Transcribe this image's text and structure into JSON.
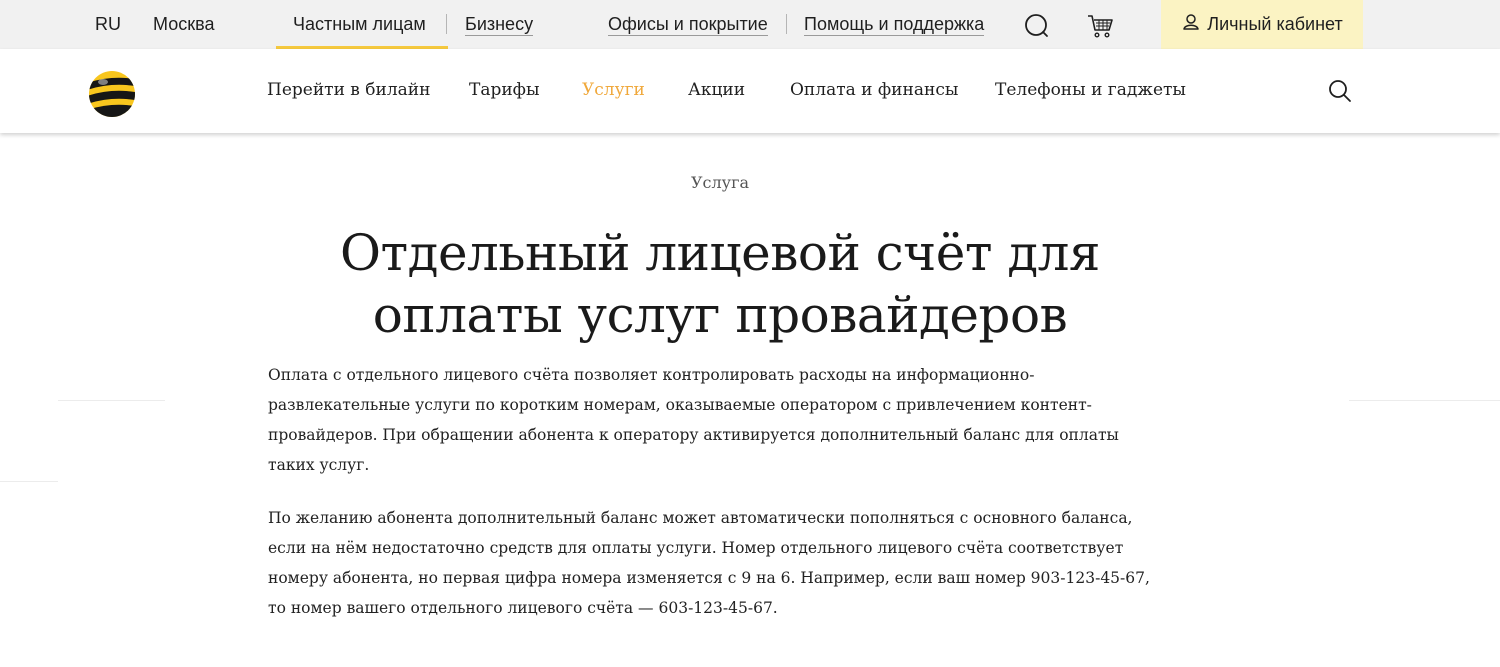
{
  "topbar": {
    "lang": "RU",
    "city": "Москва",
    "segments": {
      "private": "Частным лицам",
      "business": "Бизнесу"
    },
    "offices": "Офисы и покрытие",
    "help": "Помощь и поддержка",
    "cabinet": "Личный кабинет"
  },
  "nav": {
    "items": [
      "Перейти в билайн",
      "Тарифы",
      "Услуги",
      "Акции",
      "Оплата и финансы",
      "Телефоны и гаджеты"
    ],
    "active_index": 2
  },
  "content": {
    "eyebrow": "Услуга",
    "title_line1": "Отдельный лицевой счёт для",
    "title_line2": "оплаты услуг провайдеров",
    "paragraphs": [
      "Оплата с отдельного лицевого счёта позволяет контролировать расходы на информационно-развлекательные услуги по коротким номерам, оказываемые оператором с привлечением контент-провайдеров. При обращении абонента к оператору активируется дополнительный баланс для оплаты таких услуг.",
      "По желанию абонента дополнительный баланс может автоматически пополняться с основного баланса, если на нём недостаточно средств для оплаты услуги. Номер отдельного лицевого счёта соответствует номеру абонента, но первая цифра номера изменяется с 9 на 6. Например, если ваш номер 903-123-45-67, то номер вашего отдельного лицевого счёта — 603-123-45-67."
    ]
  },
  "colors": {
    "accent": "#f0a83b",
    "brand_yellow": "#f5c93e",
    "topbar_bg": "#f1f1f1",
    "cabinet_bg": "#fbf3c3"
  },
  "icons": [
    "chat-icon",
    "cart-icon",
    "user-icon",
    "beeline-logo",
    "search-icon"
  ]
}
